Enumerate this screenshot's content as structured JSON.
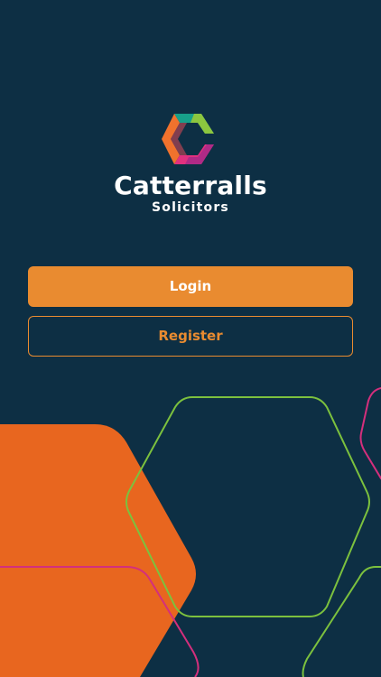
{
  "brand": {
    "name": "Catterralls",
    "subtitle": "Solicitors"
  },
  "actions": {
    "login_label": "Login",
    "register_label": "Register"
  },
  "colors": {
    "background": "#0d2f44",
    "accent_orange": "#e98b30",
    "shape_orange": "#e8661f",
    "line_green": "#7cc13e",
    "line_pink": "#d42f7c",
    "logo_teal": "#17a08a",
    "logo_green": "#8cc63f",
    "logo_pink": "#e2317f",
    "logo_orange": "#f0722d"
  }
}
